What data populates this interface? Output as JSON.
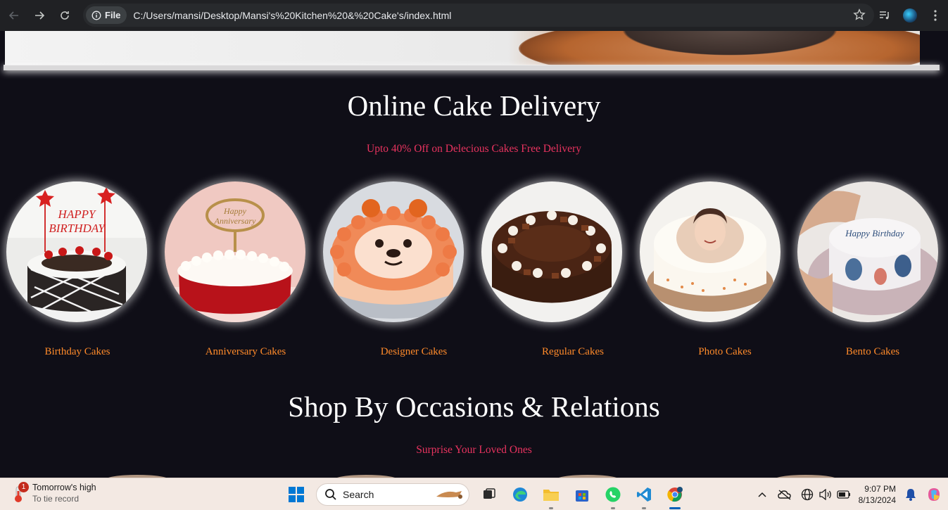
{
  "browser": {
    "chip_label": "File",
    "url": "C:/Users/mansi/Desktop/Mansi's%20Kitchen%20&%20Cake's/index.html"
  },
  "section1": {
    "title": "Online Cake Delivery",
    "subtitle": "Upto 40% Off on Delecious Cakes Free Delivery",
    "categories": [
      {
        "label": "Birthday Cakes",
        "icon": "birthday-cake-image"
      },
      {
        "label": "Anniversary Cakes",
        "icon": "anniversary-cake-image"
      },
      {
        "label": "Designer Cakes",
        "icon": "designer-cake-image"
      },
      {
        "label": "Regular Cakes",
        "icon": "regular-cake-image"
      },
      {
        "label": "Photo Cakes",
        "icon": "photo-cake-image"
      },
      {
        "label": "Bento Cakes",
        "icon": "bento-cake-image"
      }
    ],
    "label_color": "#ff8a2a",
    "subtitle_color": "#e8335f"
  },
  "section2": {
    "title": "Shop By Occasions & Relations",
    "subtitle": "Surprise Your Loved Ones"
  },
  "taskbar": {
    "weather_badge": "1",
    "weather_title": "Tomorrow's high",
    "weather_sub": "To tie record",
    "search_label": "Search",
    "time": "9:07 PM",
    "date": "8/13/2024"
  }
}
